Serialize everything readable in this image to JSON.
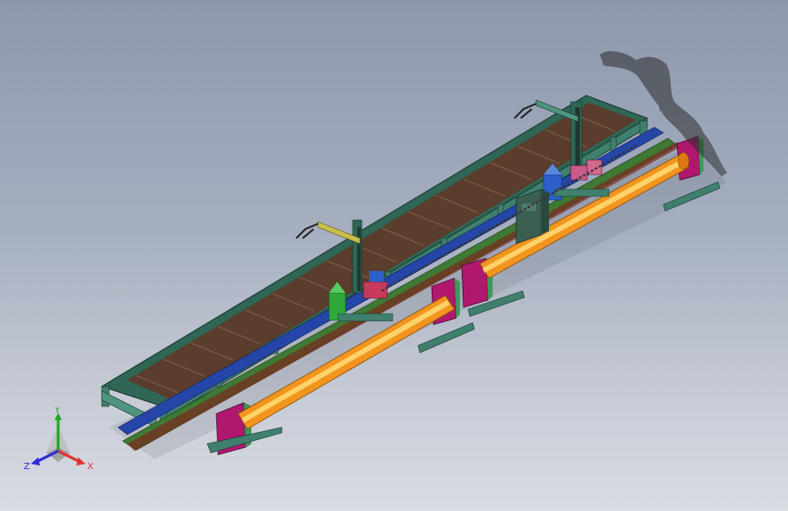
{
  "viewport": {
    "background_top": "#8d98ad",
    "background_bottom": "#d9dce2"
  },
  "model": {
    "components": [
      "roller-conveyor",
      "gantry-welding-station-left",
      "gantry-welding-station-right",
      "welding-torch-arm-left",
      "welding-torch-arm-right",
      "wire-drum-left",
      "wire-drum-right",
      "control-cabinet",
      "pipe-left",
      "pipe-right",
      "pipe-support-stands",
      "track-rails",
      "cable-chain"
    ],
    "colors": {
      "frame": "#3f7f6e",
      "conveyor_bed": "#5a3d2c",
      "pipe": "#f2951e",
      "pipe_highlight": "#ffd36a",
      "rail_blue": "#2546a8",
      "stand_magenta": "#b0186e",
      "stand_green": "#3d9b5a",
      "drum_blue": "#2c5fc8",
      "drum_green": "#2ea83a"
    }
  },
  "triad": {
    "x_label": "X",
    "y_label": "Y",
    "z_label": "Z",
    "x_color": "#e23131",
    "y_color": "#21a521",
    "z_color": "#2b2bd8"
  }
}
